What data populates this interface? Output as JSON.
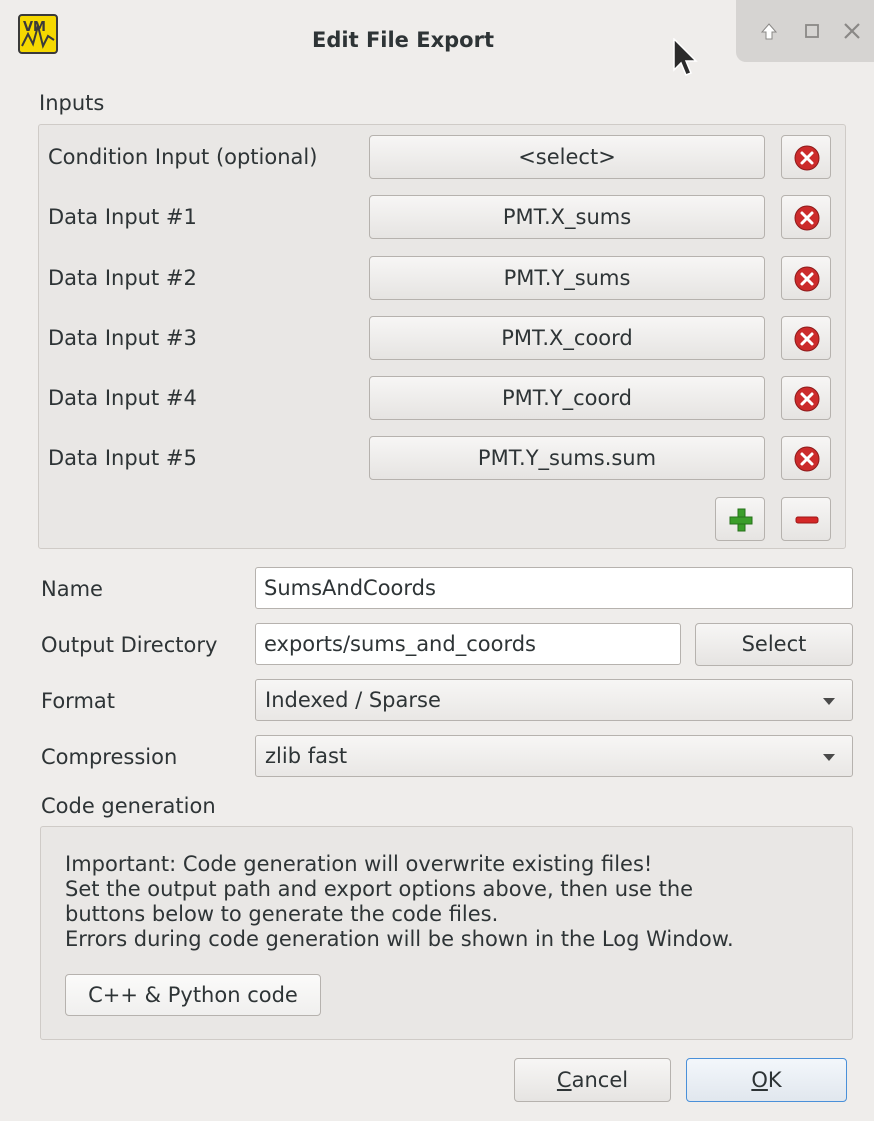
{
  "window": {
    "title": "Edit File Export",
    "logo_text": "VM"
  },
  "inputs": {
    "section_label": "Inputs",
    "condition": {
      "label": "Condition Input (optional)",
      "value": "<select>"
    },
    "data_inputs": [
      {
        "label": "Data Input #1",
        "value": "PMT.X_sums"
      },
      {
        "label": "Data Input #2",
        "value": "PMT.Y_sums"
      },
      {
        "label": "Data Input #3",
        "value": "PMT.X_coord"
      },
      {
        "label": "Data Input #4",
        "value": "PMT.Y_coord"
      },
      {
        "label": "Data Input #5",
        "value": "PMT.Y_sums.sum"
      }
    ]
  },
  "form": {
    "name_label": "Name",
    "name_value": "SumsAndCoords",
    "output_dir_label": "Output Directory",
    "output_dir_value": "exports/sums_and_coords",
    "select_button": "Select",
    "format_label": "Format",
    "format_value": "Indexed / Sparse",
    "compression_label": "Compression",
    "compression_value": "zlib fast"
  },
  "codegen": {
    "section_label": "Code generation",
    "lines": [
      "Important: Code generation will overwrite existing files!",
      "Set the output path and export options above, then use the",
      "buttons below to generate the code files.",
      "Errors during code generation will be shown in the Log Window."
    ],
    "button_label": "C++ & Python code"
  },
  "footer": {
    "cancel_first": "C",
    "cancel_rest": "ancel",
    "ok_first": "O",
    "ok_rest": "K"
  },
  "colors": {
    "window_bg": "#efedeb",
    "remove_icon": "#cc2b2b",
    "add_icon": "#3b9e2a",
    "minus_icon": "#d42727",
    "logo_bg": "#f5d800"
  }
}
